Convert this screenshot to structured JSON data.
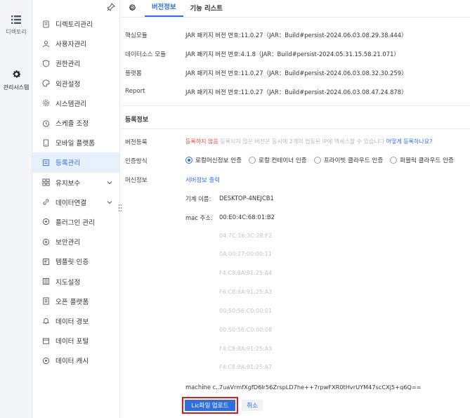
{
  "rail": {
    "items": [
      {
        "label": "디렉토리",
        "icon": "list-icon"
      },
      {
        "label": "관리시스템",
        "icon": "gear-icon"
      }
    ]
  },
  "sidebar": {
    "items": [
      {
        "label": "디렉토리관리",
        "icon": "file-icon"
      },
      {
        "label": "사용자관리",
        "icon": "user-icon"
      },
      {
        "label": "권한관리",
        "icon": "shield-icon"
      },
      {
        "label": "외관설정",
        "icon": "palette-icon"
      },
      {
        "label": "시스템관리",
        "icon": "gear-icon"
      },
      {
        "label": "스케줄 조정",
        "icon": "clock-icon"
      },
      {
        "label": "모바일 플랫폼",
        "icon": "mobile-icon"
      },
      {
        "label": "등록관리",
        "icon": "register-icon"
      },
      {
        "label": "유지보수",
        "icon": "grid-icon"
      },
      {
        "label": "데이터연결",
        "icon": "link-icon"
      },
      {
        "label": "플러그인 관리",
        "icon": "plugin-icon"
      },
      {
        "label": "보안관리",
        "icon": "plus-circle-icon"
      },
      {
        "label": "템플릿 인증",
        "icon": "template-icon"
      },
      {
        "label": "지도설정",
        "icon": "map-icon"
      },
      {
        "label": "오픈 플랫폼",
        "icon": "doc-icon"
      },
      {
        "label": "데이터 경보",
        "icon": "bell-icon"
      },
      {
        "label": "데이터 포털",
        "icon": "portal-icon"
      },
      {
        "label": "데이터 캐시",
        "icon": "cache-icon"
      }
    ]
  },
  "tabs": [
    {
      "label": "버전정보"
    },
    {
      "label": "기능 리스트"
    }
  ],
  "versions": [
    {
      "key": "핵심모듈",
      "value": "JAR 패키지 버전 번호:11.0.27（JAR：Build#persist-2024.06.03.08.29.38.444）"
    },
    {
      "key": "데이터소스 모듈",
      "value": "JAR 패키지 버전 번호:4.1.8（JAR：Build#persist-2024.05.31.15.58.21.071）"
    },
    {
      "key": "플랫폼",
      "value": "JAR 패키지 버전 번호:11.0.27（JAR：Build#persist-2024.06.03.08.32.30.259）"
    },
    {
      "key": "Report",
      "value": "JAR 패키지 버전 번호:11.0.27（JAR：Build#persist-2024.06.03.08.47.24.878）"
    }
  ],
  "registration": {
    "section_title": "등록정보",
    "version_reg_key": "버전등록",
    "status": "등록하지 않음",
    "warning": "등록되지 않은 버전은 동시에 2개의 협동된 IP에 액세스할 수 있습니다",
    "how_link": "어떻게 등록하나요?",
    "auth_key": "인증방식",
    "auth_options": [
      {
        "label": "로컬머신정보 인증",
        "selected": true
      },
      {
        "label": "로컬 컨테이너 인증",
        "selected": false
      },
      {
        "label": "프라이빗 클라우드 인증",
        "selected": false
      },
      {
        "label": "퍼블릭 클라우드 인증",
        "selected": false
      }
    ],
    "machine_key": "머신정보",
    "server_info_link": "서버정보 출력",
    "hostname_label": "기계 이름:",
    "hostname_value": "DESKTOP-4NEJCB1",
    "mac_label": "mac 주소:",
    "mac_primary": "00:E0:4C:68:01:B2",
    "mac_others": [
      "04:7C:16:3C:28:F2",
      "0A:00:27:00:00:11",
      "F4:C8:8A:91:25:A4",
      "F6:C8:8A:91:25:A3",
      "00:50:56:C0:00:01",
      "00:50:56:C0:00:08",
      "F4:C8:8A:91:25:A3",
      "F4:C8:8A:91:25:A7"
    ],
    "machine_code_label": "machine c...",
    "machine_code_value": "7uaVrmfXgfD6lr56ZrspLD7he++7rpwFXR0tHvrUYM47scCXj5+q6Q==",
    "upload_label": "Lic파일 업로드",
    "cancel_label": "취소"
  },
  "colors": {
    "accent": "#2d6fe0",
    "warning": "#e0443e",
    "highlight_box": "#e0151b"
  }
}
